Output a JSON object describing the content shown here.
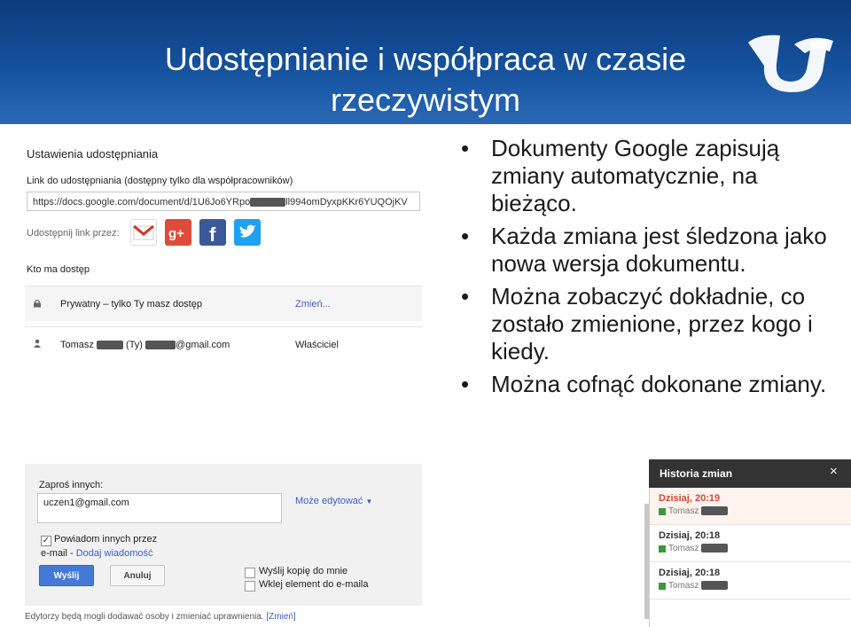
{
  "slide": {
    "title_line1": "Udostępnianie i współpraca w czasie",
    "title_line2": "rzeczywistym",
    "bullets": [
      "Dokumenty Google zapisują zmiany automatycznie, na bieżąco.",
      "Każda zmiana jest śledzona jako nowa wersja dokumentu.",
      "Można zobaczyć dokładnie, co zostało zmienione, przez kogo i kiedy.",
      "Można cofnąć dokonane zmiany."
    ]
  },
  "sharing": {
    "title": "Ustawienia udostępniania",
    "link_label": "Link do udostępniania (dostępny tylko dla współpracowników)",
    "url_start": "https://docs.google.com/document/d/1U6Jo6YRpo",
    "url_end": "ll994omDyxpKKr6YUQOjKV",
    "share_via_label": "Udostępnij link przez:",
    "share_buttons": [
      {
        "icon": "gmail-icon",
        "color": "#ffffff"
      },
      {
        "icon": "google-plus-icon",
        "color": "#dd4b39"
      },
      {
        "icon": "facebook-icon",
        "color": "#3b5998"
      },
      {
        "icon": "twitter-icon",
        "color": "#1da1f2"
      }
    ],
    "who_has_access": "Kto ma dostęp",
    "access_rows": [
      {
        "icon": "lock-icon",
        "text": "Prywatny – tylko Ty masz dostęp",
        "action": "Zmień..."
      },
      {
        "icon": "person-icon",
        "name_first": "Tomasz",
        "name_mid": "(Ty)",
        "email_domain": "@gmail.com",
        "role": "Właściciel"
      }
    ]
  },
  "invite": {
    "label": "Zaproś innych:",
    "email_value": "uczen1@gmail.com",
    "permission": "Może edytować",
    "notify_label_line1": "Powiadom innych przez",
    "notify_label_line2": "e-mail",
    "add_message": "Dodaj wiadomość",
    "send": "Wyślij",
    "cancel": "Anuluj",
    "copy_to_me": "Wyślij kopię do mnie",
    "paste_into_email": "Wklej element do e-maila",
    "footer_text": "Edytorzy będą mogli dodawać osoby i zmieniać uprawnienia.",
    "footer_link": "[Zmień]"
  },
  "history": {
    "title": "Historia zmian",
    "close": "×",
    "items": [
      {
        "time": "Dzisiaj, 20:19",
        "user": "Tomasz",
        "current": true
      },
      {
        "time": "Dzisiaj, 20:18",
        "user": "Tomasz",
        "current": false
      },
      {
        "time": "Dzisiaj, 20:18",
        "user": "Tomasz",
        "current": false
      }
    ]
  }
}
